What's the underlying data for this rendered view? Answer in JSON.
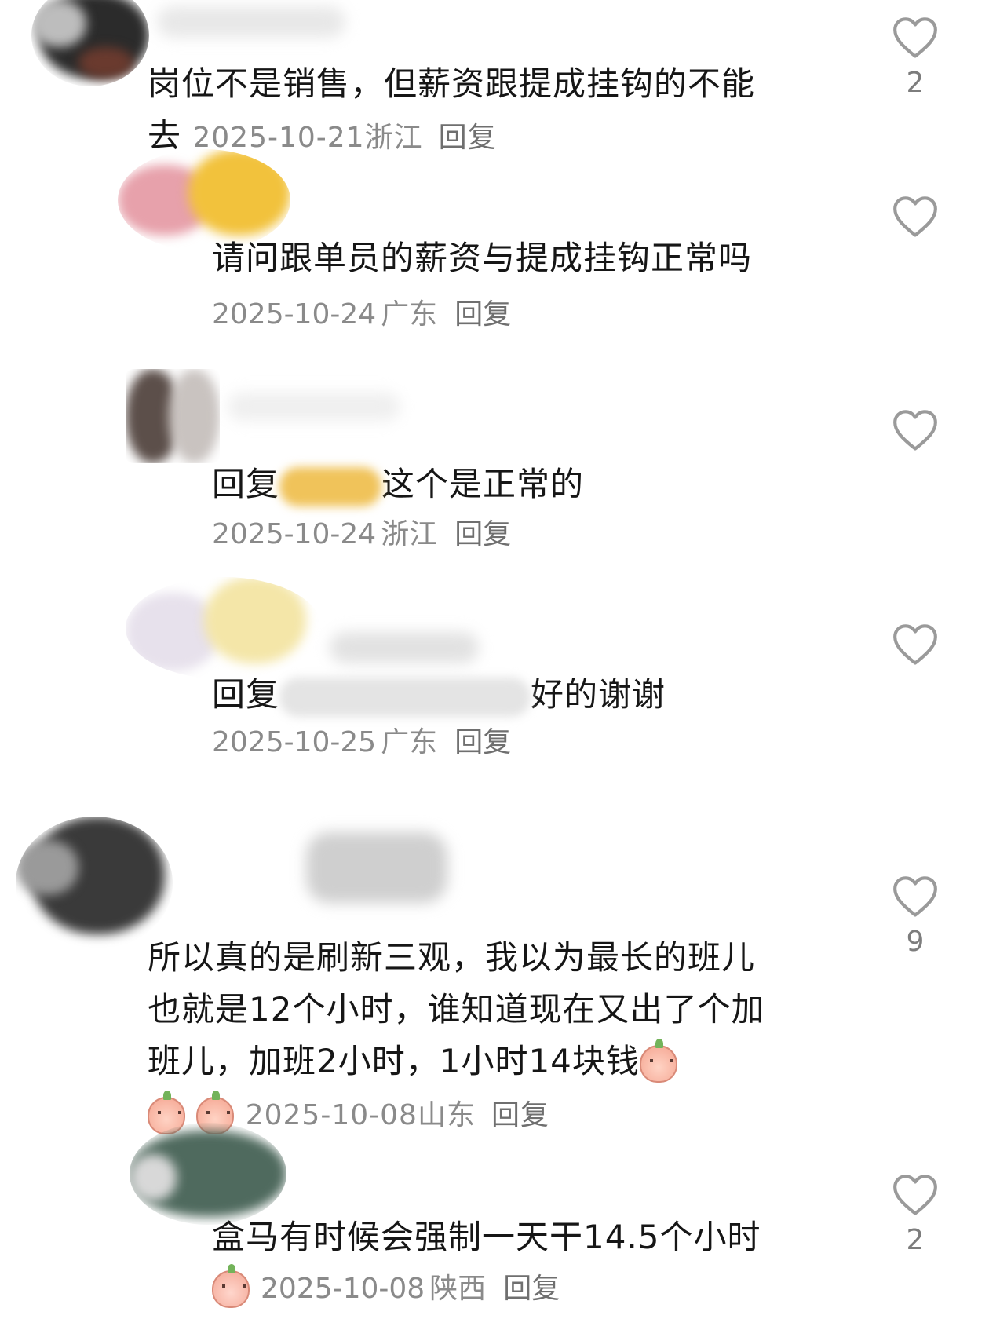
{
  "comments": [
    {
      "text": "岗位不是销售，但薪资跟提成挂钩的不能去",
      "date": "2025-10-21",
      "region": "浙江",
      "reply_label": "回复",
      "likes": "2",
      "colors": {
        "avatar": "#2b2b2b"
      }
    },
    {
      "text": "请问跟单员的薪资与提成挂钩正常吗",
      "date": "2025-10-24",
      "region": "广东",
      "reply_label": "回复",
      "colors": {
        "avatar": "#f2c23c"
      }
    },
    {
      "text_prefix": "回复",
      "text_suffix": "这个是正常的",
      "date": "2025-10-24",
      "region": "浙江",
      "reply_label": "回复",
      "colors": {
        "avatar": "#5c4f4a"
      }
    },
    {
      "text_prefix": "回复",
      "text_suffix": "好的谢谢",
      "date": "2025-10-25",
      "region": "广东",
      "reply_label": "回复",
      "colors": {
        "avatar": "#f4e6a8"
      }
    },
    {
      "text": "所以真的是刷新三观，我以为最长的班儿也就是12个小时，谁知道现在又出了个加班儿，加班2小时，1小时14块钱",
      "date": "2025-10-08",
      "region": "山东",
      "reply_label": "回复",
      "likes": "9",
      "colors": {
        "avatar": "#3a3a3a"
      }
    },
    {
      "text": "盒马有时候会强制一天干14.5个小时",
      "date": "2025-10-08",
      "region": "陕西",
      "reply_label": "回复",
      "likes": "2",
      "colors": {
        "avatar": "#4f6a5e"
      }
    }
  ],
  "icons": {
    "like": "heart-outline-icon",
    "emoji": "peach-face-emoji",
    "emoji_cry": "crying-face-emoji"
  },
  "colors": {
    "text": "#161616",
    "meta": "#8a8a8a",
    "heart": "#9a9a9a"
  }
}
